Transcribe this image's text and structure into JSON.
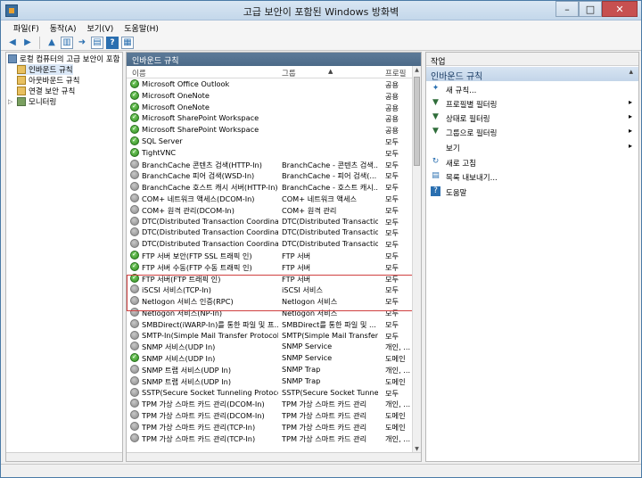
{
  "window": {
    "title": "고급 보안이 포함된 Windows 방화벽",
    "min": "–",
    "max": "□",
    "close": "✕"
  },
  "menu": [
    "파일(F)",
    "동작(A)",
    "보기(V)",
    "도움말(H)"
  ],
  "tree": {
    "root": "로컬 컴퓨터의 고급 보안이 포함",
    "items": [
      "인바운드 규칙",
      "아웃바운드 규칙",
      "연결 보안 규칙",
      "모니터링"
    ]
  },
  "center": {
    "title": "인바운드 규칙",
    "columns": {
      "name": "이름",
      "group": "그룹",
      "profile": "프로필"
    },
    "rows": [
      {
        "on": true,
        "name": "Microsoft Office Outlook",
        "group": "",
        "profile": "공용"
      },
      {
        "on": true,
        "name": "Microsoft OneNote",
        "group": "",
        "profile": "공용"
      },
      {
        "on": true,
        "name": "Microsoft OneNote",
        "group": "",
        "profile": "공용"
      },
      {
        "on": true,
        "name": "Microsoft SharePoint Workspace",
        "group": "",
        "profile": "공용"
      },
      {
        "on": true,
        "name": "Microsoft SharePoint Workspace",
        "group": "",
        "profile": "공용"
      },
      {
        "on": true,
        "name": "SQL Server",
        "group": "",
        "profile": "모두"
      },
      {
        "on": true,
        "name": "TightVNC",
        "group": "",
        "profile": "모두"
      },
      {
        "on": false,
        "name": "BranchCache 콘텐츠 검색(HTTP-In)",
        "group": "BranchCache - 콘텐츠 검색...",
        "profile": "모두"
      },
      {
        "on": false,
        "name": "BranchCache 피어 검색(WSD-In)",
        "group": "BranchCache - 피어 검색(...",
        "profile": "모두"
      },
      {
        "on": false,
        "name": "BranchCache 호스트 캐시 서버(HTTP-In)",
        "group": "BranchCache - 호스트 캐시...",
        "profile": "모두"
      },
      {
        "on": false,
        "name": "COM+ 네트워크 액세스(DCOM-In)",
        "group": "COM+ 네트워크 액세스",
        "profile": "모두"
      },
      {
        "on": false,
        "name": "COM+ 원격 관리(DCOM-In)",
        "group": "COM+ 원격 관리",
        "profile": "모두"
      },
      {
        "on": false,
        "name": "DTC(Distributed Transaction Coordinato...",
        "group": "DTC(Distributed Transaction...",
        "profile": "모두"
      },
      {
        "on": false,
        "name": "DTC(Distributed Transaction Coordinato...",
        "group": "DTC(Distributed Transaction...",
        "profile": "모두"
      },
      {
        "on": false,
        "name": "DTC(Distributed Transaction Coordinato...",
        "group": "DTC(Distributed Transaction...",
        "profile": "모두"
      },
      {
        "on": true,
        "name": "FTP 서버 보안(FTP SSL 트래픽 인)",
        "group": "FTP 서버",
        "profile": "모두"
      },
      {
        "on": true,
        "name": "FTP 서버 수동(FTP 수동 트래픽 인)",
        "group": "FTP 서버",
        "profile": "모두"
      },
      {
        "on": true,
        "name": "FTP 서버(FTP 트래픽 인)",
        "group": "FTP 서버",
        "profile": "모두"
      },
      {
        "on": false,
        "name": "iSCSI 서비스(TCP-In)",
        "group": "iSCSI 서비스",
        "profile": "모두"
      },
      {
        "on": false,
        "name": "Netlogon 서비스 인증(RPC)",
        "group": "Netlogon 서비스",
        "profile": "모두"
      },
      {
        "on": false,
        "name": "Netlogon 서비스(NP-In)",
        "group": "Netlogon 서비스",
        "profile": "모두"
      },
      {
        "on": false,
        "name": "SMBDirect(iWARP-In)를 통한 파일 및 프...",
        "group": "SMBDirect를 통한 파일 및 ...",
        "profile": "모두"
      },
      {
        "on": false,
        "name": "SMTP-In(Simple Mail Transfer Protocol)",
        "group": "SMTP(Simple Mail Transfer ...",
        "profile": "모두"
      },
      {
        "on": false,
        "name": "SNMP 서비스(UDP In)",
        "group": "SNMP Service",
        "profile": "개인, ..."
      },
      {
        "on": true,
        "name": "SNMP 서비스(UDP In)",
        "group": "SNMP Service",
        "profile": "도메인"
      },
      {
        "on": false,
        "name": "SNMP 트랩 서비스(UDP In)",
        "group": "SNMP Trap",
        "profile": "개인, ..."
      },
      {
        "on": false,
        "name": "SNMP 트랩 서비스(UDP In)",
        "group": "SNMP Trap",
        "profile": "도메인"
      },
      {
        "on": false,
        "name": "SSTP(Secure Socket Tunneling Protocol)...",
        "group": "SSTP(Secure Socket Tunnel...",
        "profile": "모두"
      },
      {
        "on": false,
        "name": "TPM 가상 스마트 카드 관리(DCOM-In)",
        "group": "TPM 가상 스마트 카드 관리",
        "profile": "개인, ..."
      },
      {
        "on": false,
        "name": "TPM 가상 스마트 카드 관리(DCOM-In)",
        "group": "TPM 가상 스마트 카드 관리",
        "profile": "도메인"
      },
      {
        "on": false,
        "name": "TPM 가상 스마트 카드 관리(TCP-In)",
        "group": "TPM 가상 스마트 카드 관리",
        "profile": "도메인"
      },
      {
        "on": false,
        "name": "TPM 가상 스마트 카드 관리(TCP-In)",
        "group": "TPM 가상 스마트 카드 관리",
        "profile": "개인, ..."
      }
    ]
  },
  "actions": {
    "header": "작업",
    "section": "인바운드 규칙",
    "items": [
      {
        "icon": "new-rule-icon",
        "glyph": "✦",
        "label": "새 규칙...",
        "sub": ""
      },
      {
        "icon": "filter-icon",
        "glyph": "▼",
        "label": "프로필별 필터링",
        "sub": "▸"
      },
      {
        "icon": "filter-icon",
        "glyph": "▼",
        "label": "상태로 필터링",
        "sub": "▸"
      },
      {
        "icon": "filter-icon",
        "glyph": "▼",
        "label": "그룹으로 필터링",
        "sub": "▸"
      },
      {
        "icon": "",
        "glyph": "",
        "label": "보기",
        "sub": "▸"
      },
      {
        "icon": "refresh-icon",
        "glyph": "↻",
        "label": "새로 고침",
        "sub": ""
      },
      {
        "icon": "export-icon",
        "glyph": "▤",
        "label": "목록 내보내기...",
        "sub": ""
      },
      {
        "icon": "help-icon",
        "glyph": "?",
        "label": "도움말",
        "sub": ""
      }
    ]
  },
  "colors": {
    "enabled": "#2e8a1e",
    "disabled": "#8a8a8a",
    "highlight": "#d04040"
  }
}
